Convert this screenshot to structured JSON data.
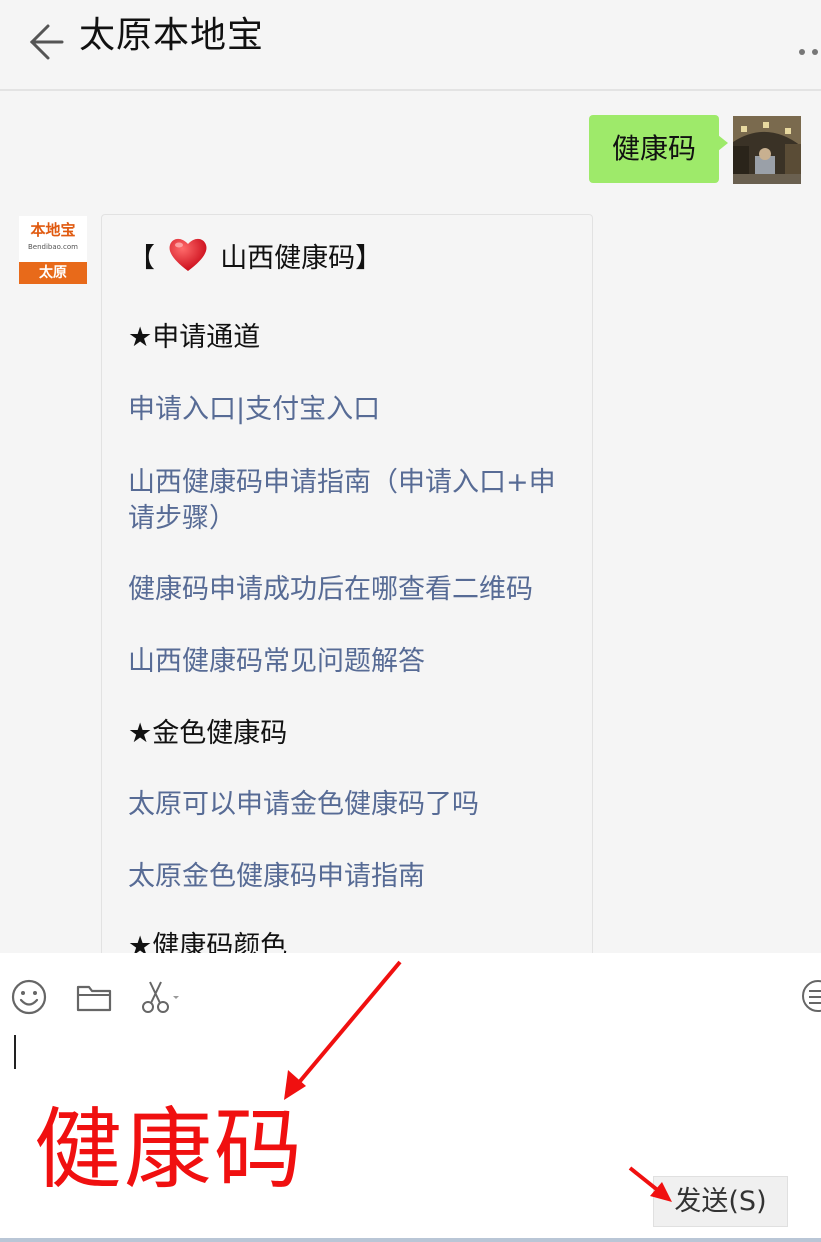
{
  "header": {
    "title": "太原本地宝",
    "back_icon": "arrow-left-icon",
    "more_icon": "more-dots-icon"
  },
  "chat": {
    "outgoing": {
      "text": "健康码",
      "bubble_color": "#9eea6a"
    },
    "bot_avatar": {
      "logo_text": "本地宝",
      "logo_sub": "Bendibao.com",
      "city": "太原"
    },
    "incoming": {
      "title_prefix": "【",
      "title_text": "山西健康码】",
      "lines": [
        {
          "text": "★申请通道",
          "kind": "heading"
        },
        {
          "text": "申请入口|支付宝入口",
          "kind": "link"
        },
        {
          "text": "山西健康码申请指南（申请入口+申请步骤）",
          "kind": "link"
        },
        {
          "text": "健康码申请成功后在哪查看二维码",
          "kind": "link"
        },
        {
          "text": "山西健康码常见问题解答",
          "kind": "link"
        },
        {
          "text": "★金色健康码",
          "kind": "heading"
        },
        {
          "text": "太原可以申请金色健康码了吗",
          "kind": "link"
        },
        {
          "text": "太原金色健康码申请指南",
          "kind": "link"
        },
        {
          "text": "★健康码颜色",
          "kind": "heading"
        }
      ],
      "link_color": "#576b95"
    }
  },
  "input": {
    "tools": [
      "emoji-icon",
      "folder-icon",
      "scissors-icon",
      "chat-history-icon"
    ],
    "annotation": "健康码",
    "send_label": "发送(S)",
    "annotation_color": "#f01010"
  }
}
